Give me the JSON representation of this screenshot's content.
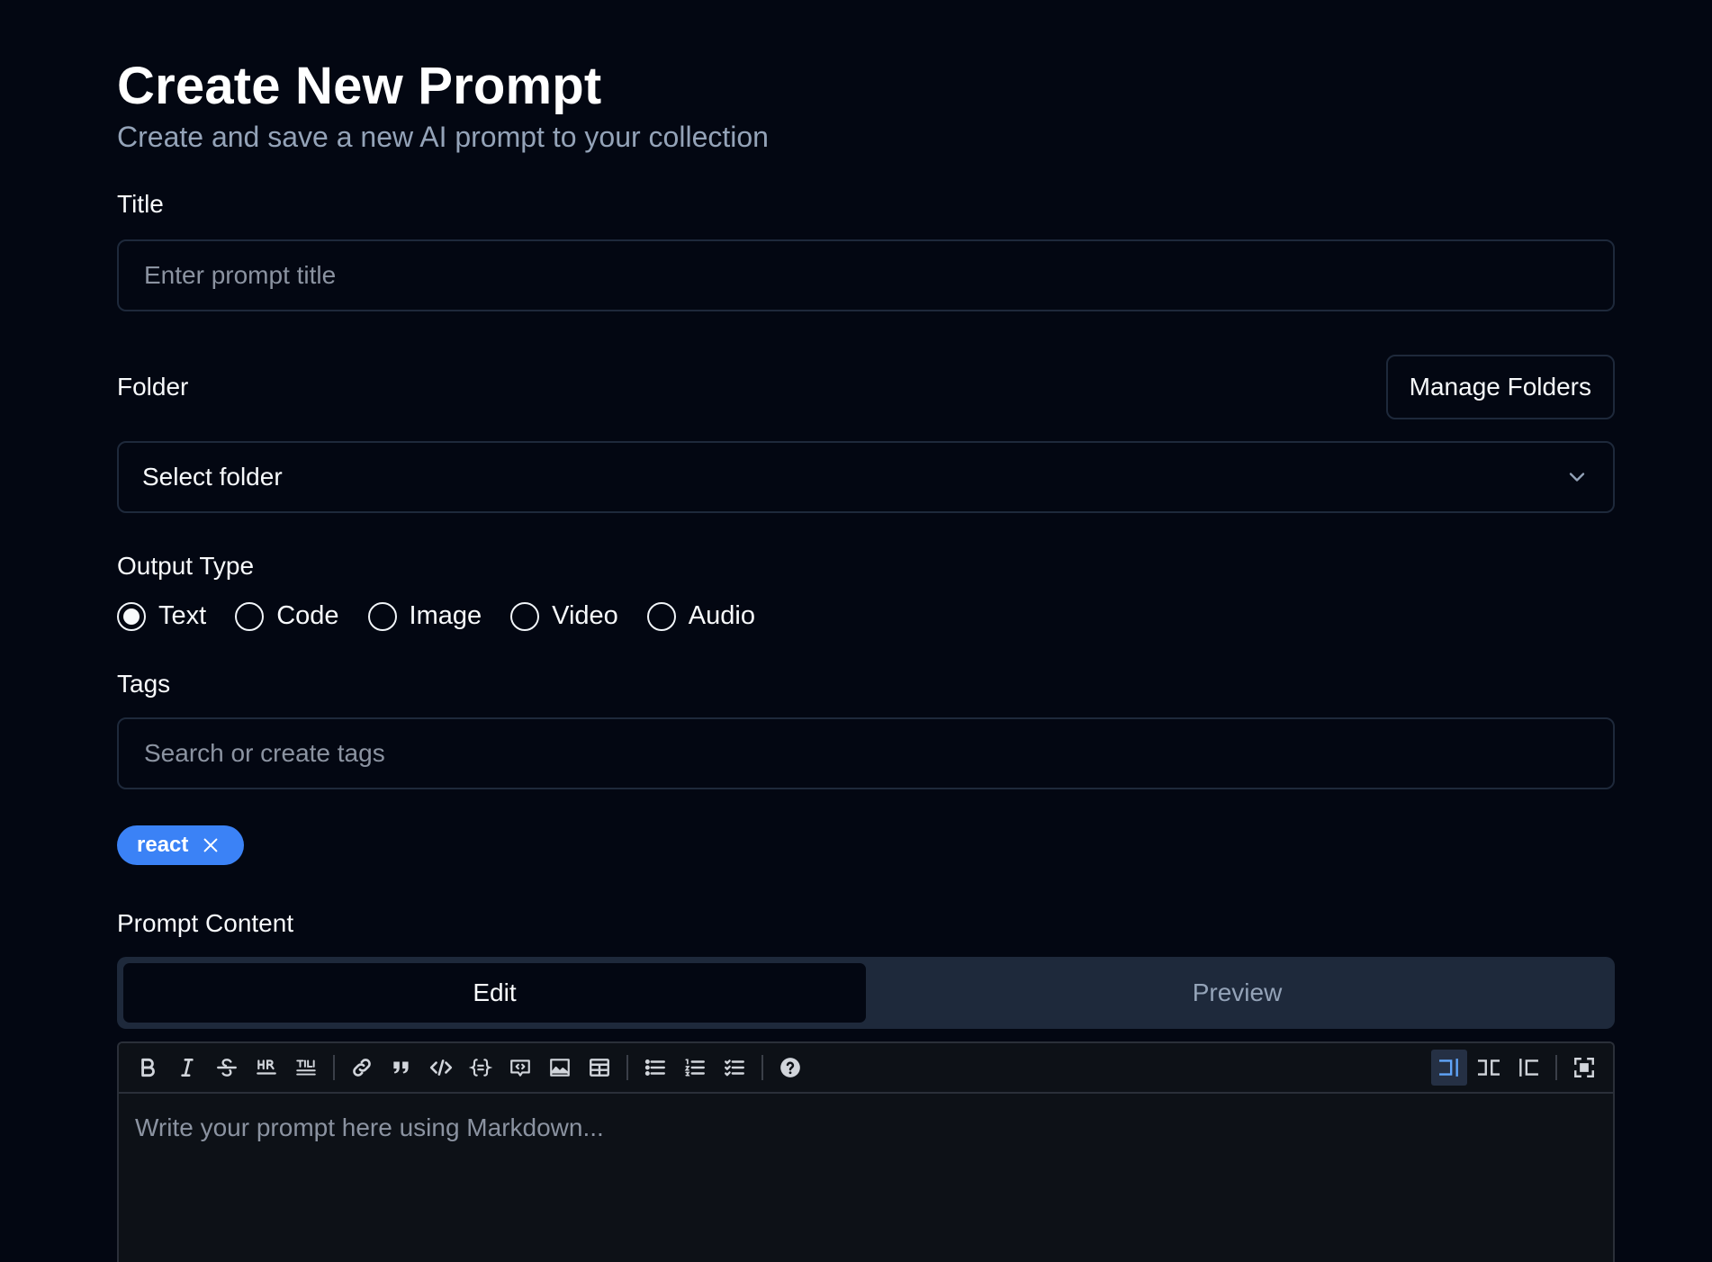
{
  "header": {
    "title": "Create New Prompt",
    "subtitle": "Create and save a new AI prompt to your collection"
  },
  "form": {
    "title_label": "Title",
    "title_placeholder": "Enter prompt title",
    "title_value": "",
    "folder_label": "Folder",
    "manage_folders_label": "Manage Folders",
    "folder_select_value": "Select folder",
    "output_type_label": "Output Type",
    "output_types": [
      {
        "label": "Text",
        "selected": true
      },
      {
        "label": "Code",
        "selected": false
      },
      {
        "label": "Image",
        "selected": false
      },
      {
        "label": "Video",
        "selected": false
      },
      {
        "label": "Audio",
        "selected": false
      }
    ],
    "tags_label": "Tags",
    "tags_placeholder": "Search or create tags",
    "tags": [
      "react"
    ],
    "content_label": "Prompt Content",
    "tabs": [
      {
        "label": "Edit",
        "active": true
      },
      {
        "label": "Preview",
        "active": false
      }
    ],
    "editor_placeholder": "Write your prompt here using Markdown..."
  },
  "toolbar": {
    "groups": [
      [
        "bold-icon",
        "italic-icon",
        "strikethrough-icon",
        "horizontal-rule-icon",
        "heading-icon"
      ],
      [
        "link-icon",
        "quote-icon",
        "code-icon",
        "code-block-icon",
        "comment-icon",
        "image-icon",
        "table-icon"
      ],
      [
        "unordered-list-icon",
        "ordered-list-icon",
        "checklist-icon"
      ],
      [
        "help-icon"
      ]
    ],
    "right": [
      "edit-mode-icon",
      "live-mode-icon",
      "preview-mode-icon",
      "fullscreen-icon"
    ],
    "active_mode": "edit-mode-icon"
  },
  "colors": {
    "background": "#030712",
    "accent": "#3b82f6",
    "muted_text": "#94a3b8",
    "border": "#1e293b"
  }
}
